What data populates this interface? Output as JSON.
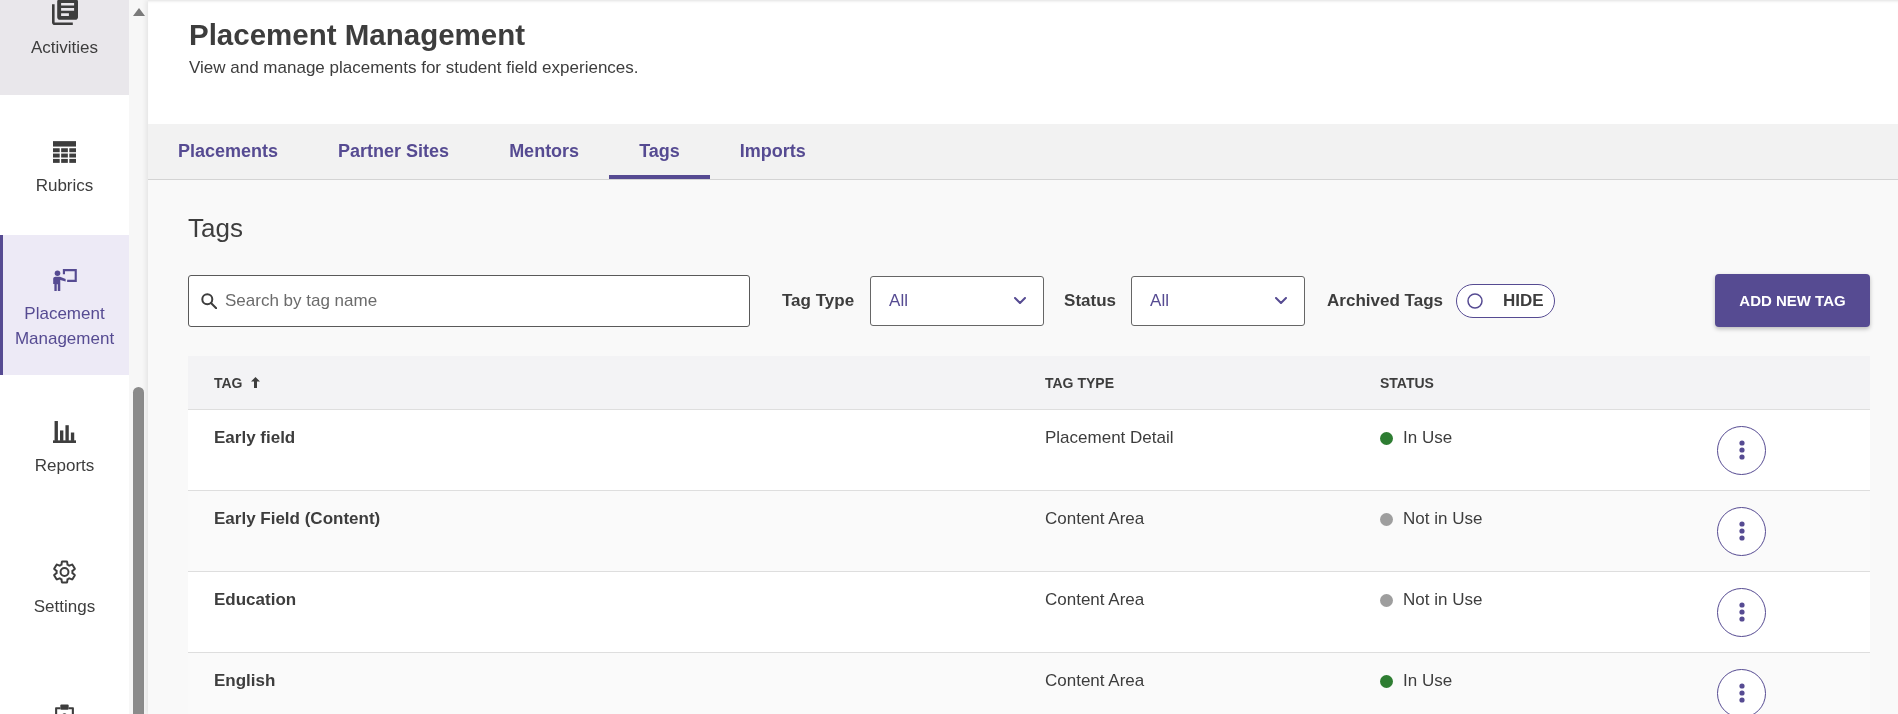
{
  "sidebar": {
    "items": [
      {
        "label": "Activities",
        "selected": false,
        "hovered": true
      },
      {
        "label": "Rubrics",
        "selected": false,
        "hovered": false
      },
      {
        "label": "Placement Management",
        "selected": true,
        "hovered": false
      },
      {
        "label": "Reports",
        "selected": false,
        "hovered": false
      },
      {
        "label": "Settings",
        "selected": false,
        "hovered": false
      },
      {
        "selected": false,
        "hovered": false
      }
    ]
  },
  "header": {
    "title": "Placement Management",
    "subtitle": "View and manage placements for student field experiences."
  },
  "tabs": [
    {
      "label": "Placements",
      "selected": false
    },
    {
      "label": "Partner Sites",
      "selected": false
    },
    {
      "label": "Mentors",
      "selected": false
    },
    {
      "label": "Tags",
      "selected": true
    },
    {
      "label": "Imports",
      "selected": false
    }
  ],
  "section": {
    "title": "Tags"
  },
  "filters": {
    "search": {
      "placeholder": "Search by tag name"
    },
    "tag_type": {
      "label": "Tag Type",
      "value": "All"
    },
    "status": {
      "label": "Status",
      "value": "All"
    },
    "archived": {
      "label": "Archived Tags",
      "toggle_text": "HIDE",
      "on": false
    },
    "add_button": "ADD NEW TAG"
  },
  "table": {
    "columns": [
      {
        "label": "TAG",
        "sorted": true
      },
      {
        "label": "TAG TYPE",
        "sorted": false
      },
      {
        "label": "STATUS",
        "sorted": false
      }
    ],
    "rows": [
      {
        "tag": "Early field",
        "tag_type": "Placement Detail",
        "status": "In Use",
        "color": "#2e7d32"
      },
      {
        "tag": "Early Field (Content)",
        "tag_type": "Content Area",
        "status": "Not in Use",
        "color": "#9e9e9e"
      },
      {
        "tag": "Education",
        "tag_type": "Content Area",
        "status": "Not in Use",
        "color": "#9e9e9e"
      },
      {
        "tag": "English",
        "tag_type": "Content Area",
        "status": "In Use",
        "color": "#2e7d32"
      }
    ]
  }
}
